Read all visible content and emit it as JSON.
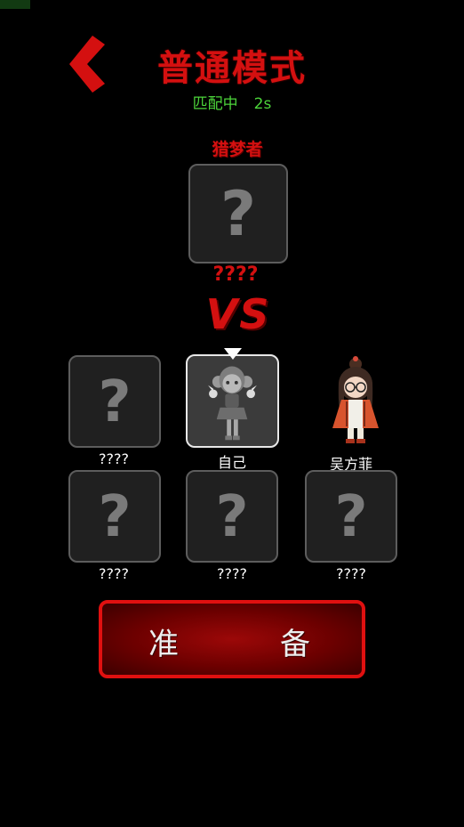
{
  "header": {
    "back_icon": "chevron-left-icon",
    "title": "普通模式",
    "status_text": "匹配中",
    "timer": "2s"
  },
  "hunter": {
    "role_label": "猎梦者",
    "name": "????",
    "icon": "question-mark-icon"
  },
  "vs_label": "VS",
  "players": [
    {
      "name": "????",
      "state": "unknown"
    },
    {
      "name": "自己",
      "state": "self"
    },
    {
      "name": "吴方菲",
      "state": "revealed"
    },
    {
      "name": "????",
      "state": "unknown"
    },
    {
      "name": "????",
      "state": "unknown"
    },
    {
      "name": "????",
      "state": "unknown"
    }
  ],
  "ready_button": {
    "char1": "准",
    "char2": "备"
  },
  "colors": {
    "accent_red": "#d41010",
    "status_green": "#4cd43a",
    "slot_bg": "#202020",
    "slot_border": "#5d5d5d"
  }
}
